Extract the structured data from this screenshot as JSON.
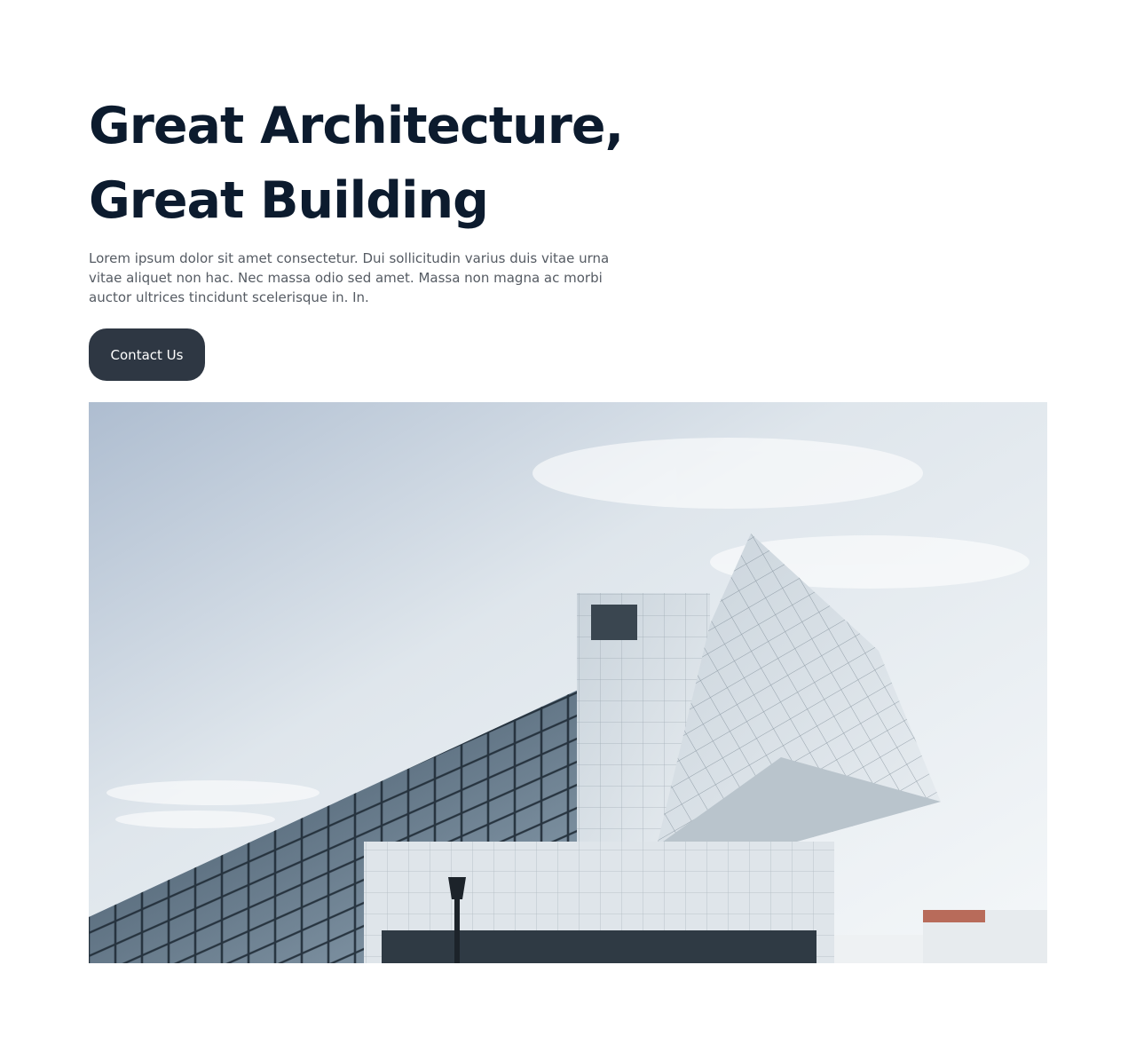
{
  "hero": {
    "title_line_1": "Great Architecture,",
    "title_line_2": "Great Building",
    "description": "Lorem ipsum dolor sit amet consectetur. Dui sollicitudin varius duis vitae urna vitae aliquet non hac. Nec massa odio sed amet. Massa non magna ac morbi auctor ultrices tincidunt scelerisque in. In.",
    "cta_label": "Contact Us"
  },
  "colors": {
    "heading": "#0c1b2e",
    "body_text": "#555b63",
    "button_bg": "#2e3743",
    "button_text": "#ffffff"
  },
  "image": {
    "subject": "modern-architecture-photo"
  }
}
